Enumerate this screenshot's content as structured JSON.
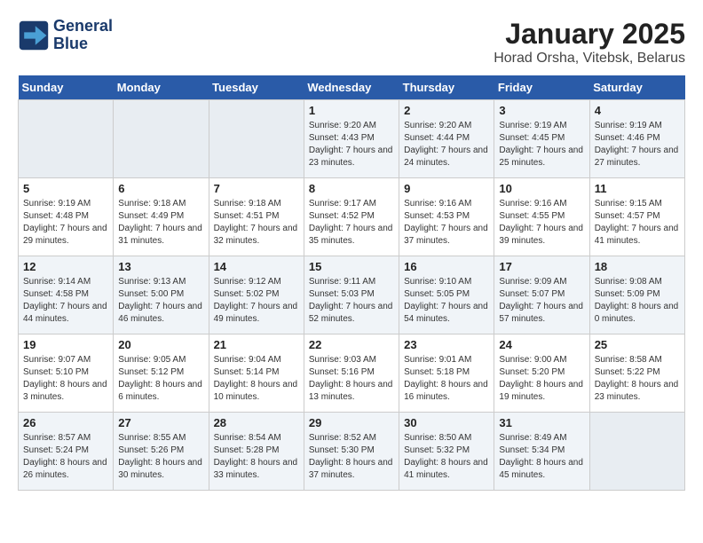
{
  "header": {
    "logo_line1": "General",
    "logo_line2": "Blue",
    "title": "January 2025",
    "subtitle": "Horad Orsha, Vitebsk, Belarus"
  },
  "days_of_week": [
    "Sunday",
    "Monday",
    "Tuesday",
    "Wednesday",
    "Thursday",
    "Friday",
    "Saturday"
  ],
  "weeks": [
    [
      {
        "day": "",
        "info": ""
      },
      {
        "day": "",
        "info": ""
      },
      {
        "day": "",
        "info": ""
      },
      {
        "day": "1",
        "info": "Sunrise: 9:20 AM\nSunset: 4:43 PM\nDaylight: 7 hours and 23 minutes."
      },
      {
        "day": "2",
        "info": "Sunrise: 9:20 AM\nSunset: 4:44 PM\nDaylight: 7 hours and 24 minutes."
      },
      {
        "day": "3",
        "info": "Sunrise: 9:19 AM\nSunset: 4:45 PM\nDaylight: 7 hours and 25 minutes."
      },
      {
        "day": "4",
        "info": "Sunrise: 9:19 AM\nSunset: 4:46 PM\nDaylight: 7 hours and 27 minutes."
      }
    ],
    [
      {
        "day": "5",
        "info": "Sunrise: 9:19 AM\nSunset: 4:48 PM\nDaylight: 7 hours and 29 minutes."
      },
      {
        "day": "6",
        "info": "Sunrise: 9:18 AM\nSunset: 4:49 PM\nDaylight: 7 hours and 31 minutes."
      },
      {
        "day": "7",
        "info": "Sunrise: 9:18 AM\nSunset: 4:51 PM\nDaylight: 7 hours and 32 minutes."
      },
      {
        "day": "8",
        "info": "Sunrise: 9:17 AM\nSunset: 4:52 PM\nDaylight: 7 hours and 35 minutes."
      },
      {
        "day": "9",
        "info": "Sunrise: 9:16 AM\nSunset: 4:53 PM\nDaylight: 7 hours and 37 minutes."
      },
      {
        "day": "10",
        "info": "Sunrise: 9:16 AM\nSunset: 4:55 PM\nDaylight: 7 hours and 39 minutes."
      },
      {
        "day": "11",
        "info": "Sunrise: 9:15 AM\nSunset: 4:57 PM\nDaylight: 7 hours and 41 minutes."
      }
    ],
    [
      {
        "day": "12",
        "info": "Sunrise: 9:14 AM\nSunset: 4:58 PM\nDaylight: 7 hours and 44 minutes."
      },
      {
        "day": "13",
        "info": "Sunrise: 9:13 AM\nSunset: 5:00 PM\nDaylight: 7 hours and 46 minutes."
      },
      {
        "day": "14",
        "info": "Sunrise: 9:12 AM\nSunset: 5:02 PM\nDaylight: 7 hours and 49 minutes."
      },
      {
        "day": "15",
        "info": "Sunrise: 9:11 AM\nSunset: 5:03 PM\nDaylight: 7 hours and 52 minutes."
      },
      {
        "day": "16",
        "info": "Sunrise: 9:10 AM\nSunset: 5:05 PM\nDaylight: 7 hours and 54 minutes."
      },
      {
        "day": "17",
        "info": "Sunrise: 9:09 AM\nSunset: 5:07 PM\nDaylight: 7 hours and 57 minutes."
      },
      {
        "day": "18",
        "info": "Sunrise: 9:08 AM\nSunset: 5:09 PM\nDaylight: 8 hours and 0 minutes."
      }
    ],
    [
      {
        "day": "19",
        "info": "Sunrise: 9:07 AM\nSunset: 5:10 PM\nDaylight: 8 hours and 3 minutes."
      },
      {
        "day": "20",
        "info": "Sunrise: 9:05 AM\nSunset: 5:12 PM\nDaylight: 8 hours and 6 minutes."
      },
      {
        "day": "21",
        "info": "Sunrise: 9:04 AM\nSunset: 5:14 PM\nDaylight: 8 hours and 10 minutes."
      },
      {
        "day": "22",
        "info": "Sunrise: 9:03 AM\nSunset: 5:16 PM\nDaylight: 8 hours and 13 minutes."
      },
      {
        "day": "23",
        "info": "Sunrise: 9:01 AM\nSunset: 5:18 PM\nDaylight: 8 hours and 16 minutes."
      },
      {
        "day": "24",
        "info": "Sunrise: 9:00 AM\nSunset: 5:20 PM\nDaylight: 8 hours and 19 minutes."
      },
      {
        "day": "25",
        "info": "Sunrise: 8:58 AM\nSunset: 5:22 PM\nDaylight: 8 hours and 23 minutes."
      }
    ],
    [
      {
        "day": "26",
        "info": "Sunrise: 8:57 AM\nSunset: 5:24 PM\nDaylight: 8 hours and 26 minutes."
      },
      {
        "day": "27",
        "info": "Sunrise: 8:55 AM\nSunset: 5:26 PM\nDaylight: 8 hours and 30 minutes."
      },
      {
        "day": "28",
        "info": "Sunrise: 8:54 AM\nSunset: 5:28 PM\nDaylight: 8 hours and 33 minutes."
      },
      {
        "day": "29",
        "info": "Sunrise: 8:52 AM\nSunset: 5:30 PM\nDaylight: 8 hours and 37 minutes."
      },
      {
        "day": "30",
        "info": "Sunrise: 8:50 AM\nSunset: 5:32 PM\nDaylight: 8 hours and 41 minutes."
      },
      {
        "day": "31",
        "info": "Sunrise: 8:49 AM\nSunset: 5:34 PM\nDaylight: 8 hours and 45 minutes."
      },
      {
        "day": "",
        "info": ""
      }
    ]
  ]
}
